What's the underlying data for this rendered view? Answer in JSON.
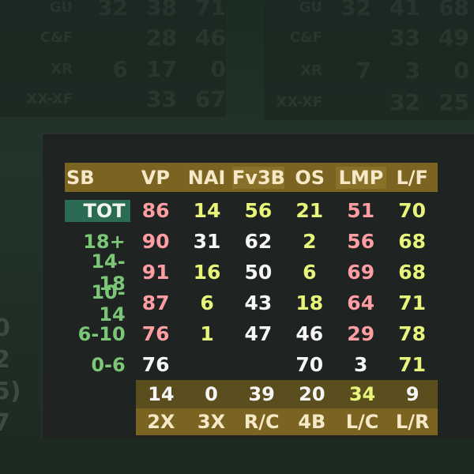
{
  "background": {
    "panel_left": {
      "rows": [
        {
          "label": "GU",
          "values": [
            "32",
            "38",
            "71"
          ]
        },
        {
          "label": "C&F",
          "values": [
            "",
            "28",
            "46"
          ]
        },
        {
          "label": "XR",
          "values": [
            "6",
            "17",
            "0"
          ]
        },
        {
          "label": "XX-XF",
          "values": [
            "",
            "33",
            "67"
          ]
        }
      ]
    },
    "panel_right": {
      "rows": [
        {
          "label": "GU",
          "values": [
            "32",
            "41",
            "68"
          ]
        },
        {
          "label": "C&F",
          "values": [
            "",
            "33",
            "49"
          ]
        },
        {
          "label": "XR",
          "values": [
            "7",
            "3",
            "0"
          ]
        },
        {
          "label": "XX-XF",
          "values": [
            "",
            "32",
            "25"
          ]
        }
      ]
    },
    "left_edge": [
      "0",
      "2",
      "5)",
      "7"
    ]
  },
  "table": {
    "header": {
      "label": "SB",
      "cols": [
        "VP",
        "NAI",
        "Fv3B",
        "OS",
        "LMP",
        "L/F"
      ]
    },
    "rows": [
      {
        "label": "TOT",
        "values": [
          "86",
          "14",
          "56",
          "21",
          "51",
          "70"
        ]
      },
      {
        "label": "18+",
        "values": [
          "90",
          "31",
          "62",
          "2",
          "56",
          "68"
        ]
      },
      {
        "label": "14-18",
        "values": [
          "91",
          "16",
          "50",
          "6",
          "69",
          "68"
        ]
      },
      {
        "label": "10-14",
        "values": [
          "87",
          "6",
          "43",
          "18",
          "64",
          "71"
        ]
      },
      {
        "label": "6-10",
        "values": [
          "76",
          "1",
          "47",
          "46",
          "29",
          "78"
        ]
      },
      {
        "label": "0-6",
        "values": [
          "76",
          "",
          "",
          "70",
          "3",
          "71"
        ]
      }
    ],
    "footer_values": [
      "14",
      "0",
      "39",
      "20",
      "34",
      "9"
    ],
    "footer_labels": [
      "2X",
      "3X",
      "R/C",
      "4B",
      "L/C",
      "L/R"
    ]
  }
}
